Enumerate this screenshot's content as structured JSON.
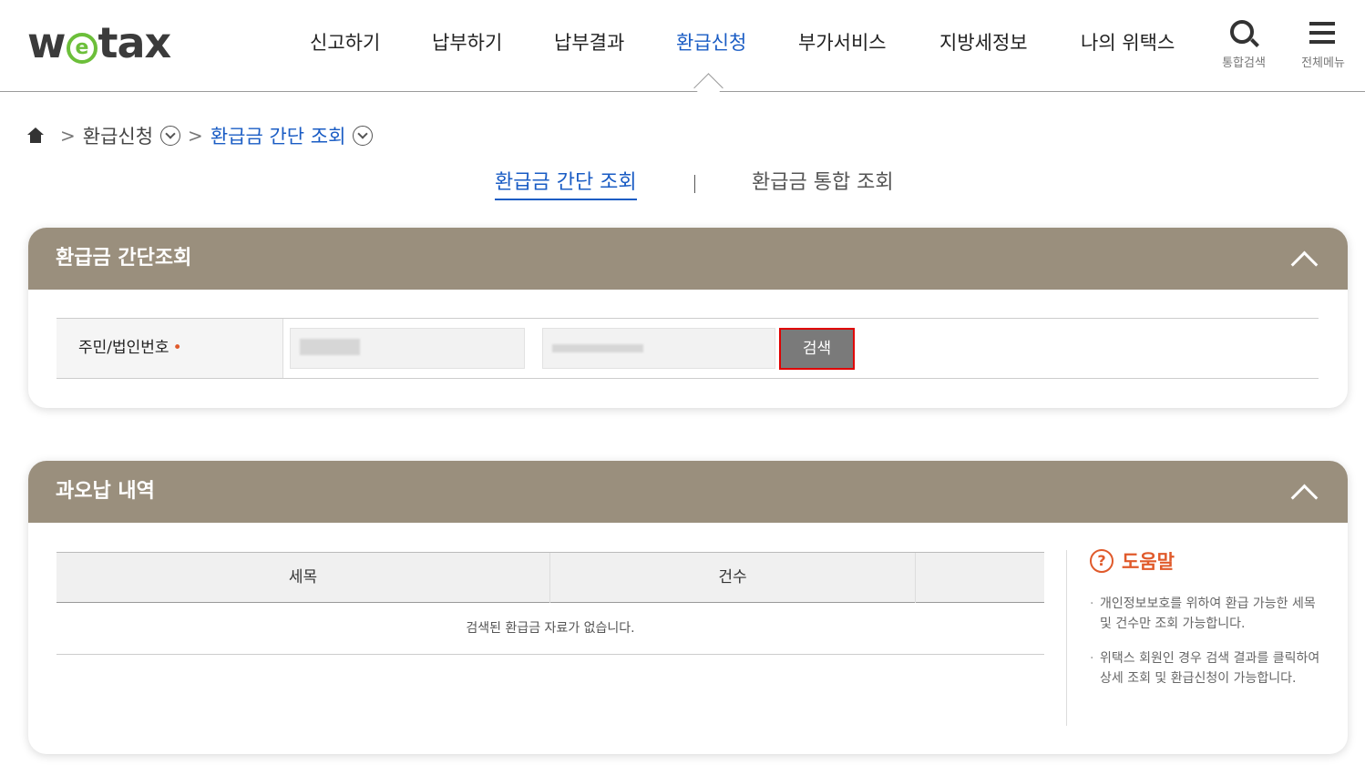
{
  "header": {
    "logo": "wetax",
    "nav": [
      "신고하기",
      "납부하기",
      "납부결과",
      "환급신청",
      "부가서비스",
      "지방세정보",
      "나의 위택스"
    ],
    "active_nav": "환급신청",
    "search_label": "통합검색",
    "menu_label": "전체메뉴"
  },
  "breadcrumb": {
    "level1": "환급신청",
    "level2": "환급금 간단 조회"
  },
  "tabs": {
    "active": "환급금 간단 조회",
    "other": "환급금 통합 조회"
  },
  "lookup_panel": {
    "title": "환급금 간단조회",
    "field_label": "주민/법인번호",
    "required_mark": "•",
    "search_button": "검색"
  },
  "overpayment_panel": {
    "title": "과오납 내역",
    "columns": [
      "세목",
      "건수",
      ""
    ],
    "empty_message": "검색된 환급금 자료가 없습니다.",
    "help": {
      "title": "도움말",
      "icon": "?",
      "items": [
        "개인정보보호를 위하여 환급 가능한 세목 및 건수만 조회 가능합니다.",
        "위택스 회원인 경우 검색 결과를 클릭하여 상세 조회 및 환급신청이 가능합니다."
      ]
    }
  },
  "colors": {
    "accent_blue": "#1a5cc4",
    "panel_header": "#9a8f7d",
    "help_orange": "#e05a2b",
    "logo_green": "#6cbf3a"
  }
}
